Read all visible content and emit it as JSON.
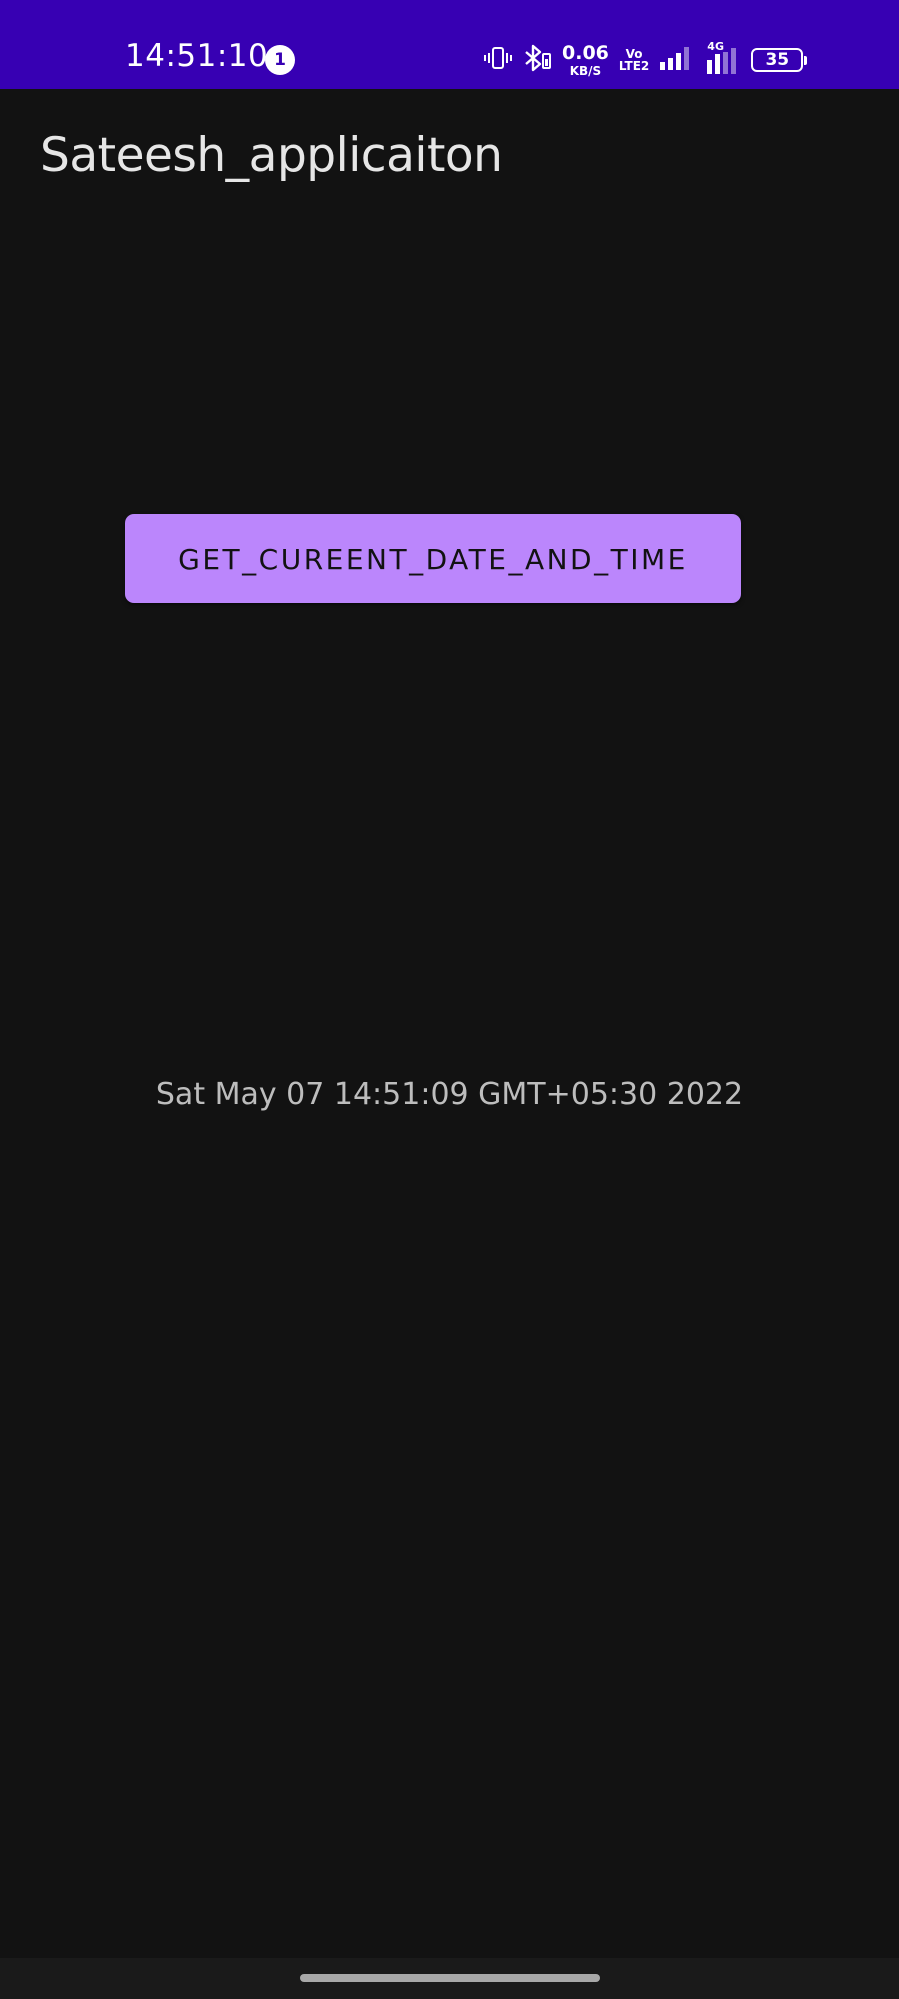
{
  "status_bar": {
    "time": "14:51:10",
    "notification_count": "1",
    "net_speed_value": "0.06",
    "net_speed_unit": "KB/S",
    "volte_top": "Vo",
    "volte_bottom": "LTE2",
    "network_type": "4G",
    "battery_level": "35",
    "background_color": "#3700b3"
  },
  "app_bar": {
    "title": "Sateesh_applicaiton"
  },
  "main": {
    "button_label": "GET_CUREENT_DATE_AND_TIME",
    "button_color": "#bb86fc",
    "date_text": "Sat May 07 14:51:09 GMT+05:30 2022"
  },
  "icons": {
    "vibrate": "vibrate-icon",
    "bluetooth": "bluetooth-icon",
    "signal1": "signal-icon",
    "signal2": "signal-4g-icon"
  }
}
